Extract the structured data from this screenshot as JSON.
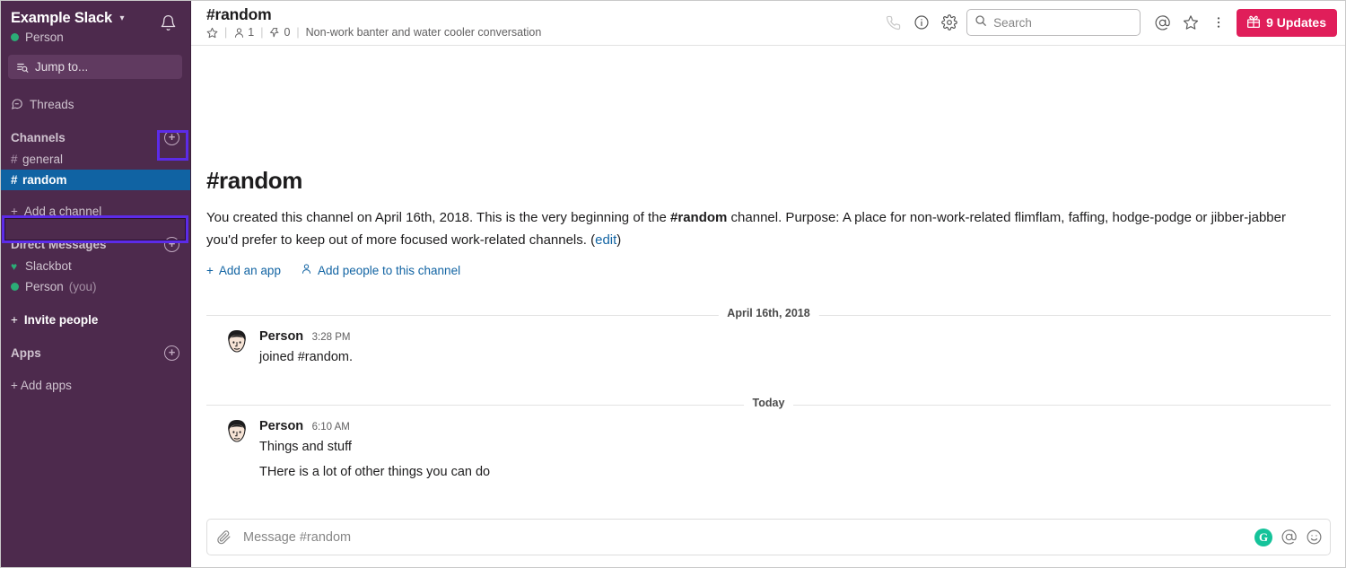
{
  "sidebar": {
    "team_name": "Example Slack",
    "team_caret": "chevron-down",
    "user_name": "Person",
    "jump_to": "Jump to...",
    "nav": [
      {
        "label": "Threads",
        "icon": "threads-icon"
      }
    ],
    "channels_section": {
      "label": "Channels",
      "add_label": "+",
      "items": [
        {
          "hash": "#",
          "name": "general",
          "active": false
        },
        {
          "hash": "#",
          "name": "random",
          "active": true
        }
      ],
      "add_channel_label": "Add a channel",
      "add_channel_plus": "+"
    },
    "dm_section": {
      "label": "Direct Messages",
      "add_label": "+",
      "items": [
        {
          "mark": "heart",
          "name": "Slackbot",
          "suffix": ""
        },
        {
          "mark": "dot",
          "name": "Person",
          "suffix": "(you)"
        }
      ]
    },
    "invite_people": {
      "plus": "+",
      "label": "Invite people"
    },
    "apps_section": {
      "label": "Apps",
      "add_label": "+",
      "add_apps_label": "+ Add apps"
    }
  },
  "header": {
    "channel_title": "#random",
    "star_icon": "star-outline-icon",
    "members_count": "1",
    "pins_count": "0",
    "topic": "Non-work banter and water cooler conversation",
    "call_icon": "phone-icon",
    "info_icon": "info-circle-icon",
    "settings_icon": "gear-icon",
    "search": {
      "placeholder": "Search",
      "icon": "search-icon",
      "value": ""
    },
    "mention_icon": "at-mention-icon",
    "star_right_icon": "star-outline-icon",
    "more_icon": "kebab-menu-icon",
    "updates": {
      "label": "9 Updates",
      "icon": "gift-icon",
      "color": "#E01E5A"
    }
  },
  "main": {
    "intro": {
      "title": "#random",
      "text_1": "You created this channel on April 16th, 2018. This is the very beginning of the ",
      "channel_bold": "#random",
      "text_2": " channel. Purpose: A place for non-work-related flimflam, faffing, hodge-podge or jibber-jabber you'd prefer to keep out of more focused work-related channels. (",
      "edit_link": "edit",
      "text_3": ")",
      "add_app": "Add an app",
      "add_people": "Add people to this channel"
    },
    "dividers": {
      "date_1": "April 16th, 2018",
      "date_2": "Today"
    },
    "messages": [
      {
        "author": "Person",
        "time": "3:28 PM",
        "lines": [
          "joined #random."
        ]
      },
      {
        "author": "Person",
        "time": "6:10 AM",
        "lines": [
          "Things and stuff",
          "THere is a lot of other things you can do"
        ]
      }
    ]
  },
  "composer": {
    "attach_icon": "paperclip-icon",
    "placeholder": "Message #random",
    "value": "",
    "grammarly_icon": "G",
    "mention_icon": "at-mention-icon",
    "emoji_icon": "emoji-smiley-icon"
  },
  "colors": {
    "sidebar_bg": "#4D2A4D",
    "active_channel": "#1063A3",
    "highlight_box": "#5C2BE8",
    "updates_btn": "#E01E5A",
    "link": "#1264A3",
    "grammarly": "#15C39A",
    "presence_green": "#2BAC76"
  },
  "annotations": {
    "highlight_add_channel_plus": "add-channel-plus-highlight",
    "highlight_add_channel_row": "add-a-channel-highlight"
  }
}
